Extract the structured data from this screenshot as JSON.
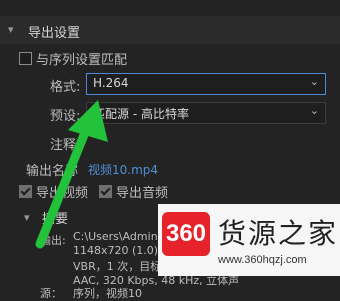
{
  "section": {
    "title": "导出设置"
  },
  "match_sequence": {
    "label": "与序列设置匹配",
    "checked": false
  },
  "format": {
    "label": "格式:",
    "value": "H.264"
  },
  "preset": {
    "label": "预设:",
    "value": "匹配源 - 高比特率"
  },
  "comment": {
    "label": "注释"
  },
  "output_name": {
    "label": "输出名称",
    "value": "视频10.mp4"
  },
  "export_video": {
    "label": "导出视频",
    "checked": true
  },
  "export_audio": {
    "label": "导出音频",
    "checked": true
  },
  "summary": {
    "title": "摘要",
    "output_label": "输出:",
    "lines": [
      "C:\\Users\\Adminis",
      "1148x720 (1.0)",
      "VBR，1 次，目标",
      "AAC, 320 Kbps, 48 kHz, 立体声"
    ],
    "source_label": "源：",
    "source_value": "序列，视频10"
  },
  "watermark": {
    "badge": "360",
    "title": "货源之家",
    "url": "www.360hqzj.com"
  },
  "colors": {
    "arrow": "#22c23a",
    "link": "#4f8fd6",
    "badge": "#e6222a"
  }
}
